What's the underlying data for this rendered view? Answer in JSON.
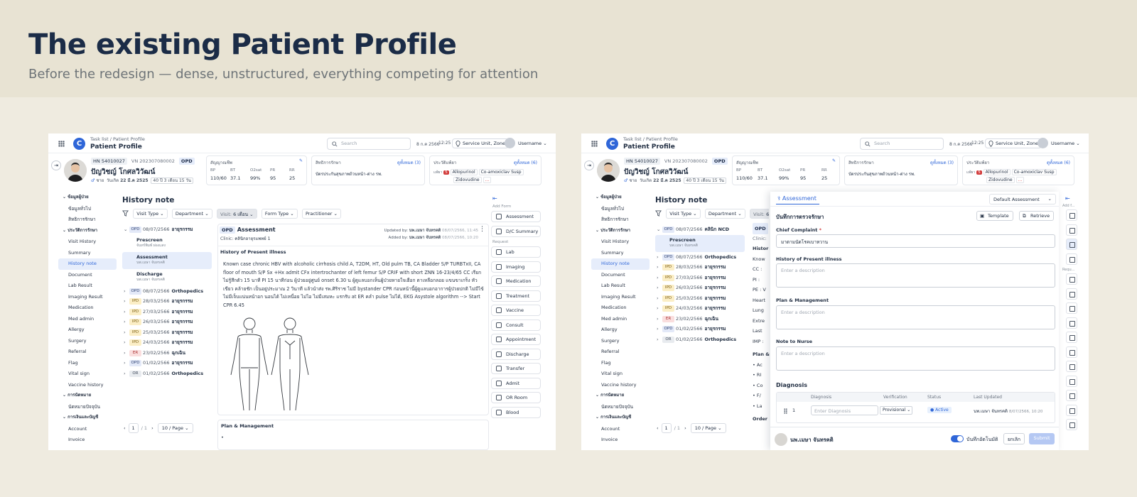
{
  "hero": {
    "title": "The existing Patient Profile",
    "subtitle": "Before the redesign — dense, unstructured, everything competing for attention"
  },
  "app": {
    "breadcrumb": "Task list / Patient Profile",
    "page_title": "Patient Profile",
    "search_placeholder": "Search",
    "date": "8 ก.ค 2566",
    "time": "12:25",
    "service_unit": "Service Unit, Zone",
    "username": "Username"
  },
  "patient": {
    "hn": "HN 54010027",
    "vn": "VN 202307080002",
    "visit_type": "OPD",
    "name": "ปัญวิชญ์ โกศลวิวัฒน์",
    "sex": "ชาย",
    "dob_label": "วันเกิด",
    "dob": "22 มี.ค 2525",
    "age": "40 ปี 3 เดือน 15 วัน"
  },
  "vitals": {
    "label": "สัญญาณชีพ",
    "items": [
      {
        "k": "BP",
        "v": "110/60"
      },
      {
        "k": "BT",
        "v": "37.1"
      },
      {
        "k": "O2sat",
        "v": "99%"
      },
      {
        "k": "PR",
        "v": "95"
      },
      {
        "k": "RR",
        "v": "25"
      }
    ]
  },
  "rights": {
    "label": "สิทธิการรักษา",
    "link": "ดูทั้งหมด (3)",
    "value": "บัตรประกันสุขภาพถ้วนหน้า-ต่าง รพ."
  },
  "allergy": {
    "label": "ประวัติแพ้ยา",
    "link": "ดูทั้งหมด (6)",
    "prefix": "แพ้ยา",
    "count": "5",
    "drugs": [
      "Allopurinol",
      "Co-amoxiclav Susp",
      "Zidovudine"
    ],
    "more": "..."
  },
  "sidebar": {
    "items": [
      {
        "label": "ข้อมูลผู้ป่วย",
        "head": true
      },
      {
        "label": "ข้อมูลทั่วไป"
      },
      {
        "label": "สิทธิการรักษา"
      },
      {
        "label": "ประวัติการรักษา",
        "head": true
      },
      {
        "label": "Visit History"
      },
      {
        "label": "Summary"
      },
      {
        "label": "History note",
        "active": true
      },
      {
        "label": "Document"
      },
      {
        "label": "Lab Result"
      },
      {
        "label": "Imaging Result"
      },
      {
        "label": "Medication"
      },
      {
        "label": "Med admin"
      },
      {
        "label": "Allergy"
      },
      {
        "label": "Surgery"
      },
      {
        "label": "Referral"
      },
      {
        "label": "Flag"
      },
      {
        "label": "Vital sign"
      },
      {
        "label": "Vaccine history"
      },
      {
        "label": "การนัดหมาย",
        "head": true
      },
      {
        "label": "นัดหมายปัจจุบัน"
      },
      {
        "label": "การเงินและบัญชี",
        "head": true
      },
      {
        "label": "Account"
      },
      {
        "label": "Invoice"
      }
    ]
  },
  "history": {
    "title": "History note",
    "filters": {
      "visit_type": "Visit Type",
      "department": "Department",
      "visit_prefix": "Visit:",
      "visit_value": "6 เดือน",
      "form_type": "Form Type",
      "practitioner": "Practitioner"
    },
    "timeline_a": {
      "first": {
        "type": "OPD",
        "date": "08/07/2566",
        "dept": "อายุรกรรม"
      },
      "subs": [
        {
          "title": "Prescreen",
          "by": "จันทร์พิมพ์ ผ่องแสง"
        },
        {
          "title": "Assessment",
          "by": "นพ.เมษา จันทรคติ"
        },
        {
          "title": "Discharge",
          "by": "นพ.เมษา จันทรคติ"
        }
      ]
    },
    "timeline_b": {
      "first": {
        "type": "OPD",
        "date": "08/07/2566",
        "dept": "คลินิก NCD"
      },
      "subs": [
        {
          "title": "Prescreen",
          "by": "นพ.เมษา จันทรคติ"
        }
      ]
    },
    "rows": [
      {
        "type": "OPD",
        "date": "08/07/2566",
        "dept": "Orthopedics"
      },
      {
        "type": "IPD",
        "date": "28/03/2566",
        "dept": "อายุรกรรม"
      },
      {
        "type": "IPD",
        "date": "27/03/2566",
        "dept": "อายุรกรรม"
      },
      {
        "type": "IPD",
        "date": "26/03/2566",
        "dept": "อายุรกรรม"
      },
      {
        "type": "IPD",
        "date": "25/03/2566",
        "dept": "อายุรกรรม"
      },
      {
        "type": "IPD",
        "date": "24/03/2566",
        "dept": "อายุรกรรม"
      },
      {
        "type": "ER",
        "date": "23/02/2566",
        "dept": "ฉุกเฉิน"
      },
      {
        "type": "OPD",
        "date": "01/02/2566",
        "dept": "อายุรกรรม"
      },
      {
        "type": "OR",
        "date": "01/02/2566",
        "dept": "Orthopedics"
      }
    ],
    "page": "1",
    "of_pages": "/ 1",
    "per_page": "10 / Page"
  },
  "assessment": {
    "type": "OPD",
    "title": "Assessment",
    "clinic_label": "Clinic:",
    "clinic": "คลินิกอายุรแพทย์ 1",
    "updated_by_label": "Updated by:",
    "updated_by": "นพ.เมษา จันทรคติ",
    "updated_at": "08/07/2566, 11:45",
    "added_by_label": "Added by:",
    "added_by": "นพ.เมษา จันทรคติ",
    "added_at": "08/07/2566, 10:20",
    "section": "History of Present illness",
    "hpi": "Known case chronic HBV with alcoholic cirrhosis child A, T2DM, HT, Old pulm TB, CA Bladder S/P TURBTxII, CA floor of mouth S/P Sx +Hx admit CFx intertrochanter of left femur S/P CRIF with short ZNN 16-23/4/65 CC เรียกไม่รู้สึกตัว 15 นาที PI 15 นาทีก่อน ผู้ป่วยอยู่ศูนย์ onset 6.30 น ผู้ดูแลบอกเห็นผู้ป่วยหายใจเฮือก ตาเหลือกลอย แขนขาเกร็ง หัวเขียว คล้ายชัก เป็นอยู่ประมาณ 2 วินาที แล้วนำส่ง รพ.ศิริราช ไม่มี bystander CPR ก่อนหน้านี้ผู้ดูแลบอกอาการผู้ป่วยปกติ ไม่มีไข้ ไม่มีเจ็บแน่นหน้าอก นอนได้ ไม่เหนื่อย ไม่ไอ ไม่มีเสมหะ แรกรับ at ER คลำ pulse ไม่ได้, EKG Asystole algorithm --> Start CPR 6.45",
    "plan_label": "Plan & Management"
  },
  "add_form": {
    "label": "Add Form",
    "forms": [
      "Assessment",
      "D/C Summary"
    ],
    "request_label": "Request",
    "requests": [
      "Lab",
      "Imaging",
      "Medication",
      "Treatment",
      "Vaccine",
      "Consult",
      "Appointment",
      "Discharge",
      "Transfer",
      "Admit",
      "OR Room",
      "Blood"
    ]
  },
  "bg_b": {
    "clinic_short": "Clinic:",
    "history_short": "Histor",
    "lines": [
      "Know",
      "CC :",
      "PI :",
      "PE : V",
      "Heart",
      "Lung",
      "Extre",
      "Last",
      "IMP :"
    ],
    "plan_short": "Plan &",
    "plan_lines": [
      "• Ac",
      "• RI",
      "• Co",
      "• F/",
      "• La"
    ],
    "order_short": "Order"
  },
  "drawer": {
    "tab": "Assessment",
    "template_select": "Default Assessment",
    "record_title": "บันทึกการตรวจรักษา",
    "template_btn": "Template",
    "retrieve_btn": "Retrieve",
    "chief_complaint_label": "Chief Complaint",
    "chief_complaint_value": "มาตามนัดโรคเบาหวาน",
    "hpi_label": "History of Present illness",
    "plan_label": "Plan & Management",
    "nurse_label": "Note to Nurse",
    "placeholder": "Enter a description",
    "diagnosis_label": "Diagnosis",
    "dx_cols": [
      "Diagnosis",
      "Verification",
      "Status",
      "Last Updated"
    ],
    "dx_row": {
      "num": "1",
      "placeholder": "Enter Diagnosis",
      "verification": "Provisional",
      "status": "Active",
      "updated_by": "นพ.เมษา จันทรคติ",
      "updated_at": "8/07/2566, 10:20"
    },
    "user_name": "นพ.เมษา จันทรคติ",
    "autosave": "บันทึกอัตโนมัติ",
    "cancel": "ยกเลิก",
    "submit": "Submit",
    "rail_add": "Add f...",
    "rail_req": "Requ..."
  },
  "colors": {
    "accent": "#2f66d8",
    "hero_bg": "#e8e3d3",
    "page_bg": "#efebe0"
  }
}
